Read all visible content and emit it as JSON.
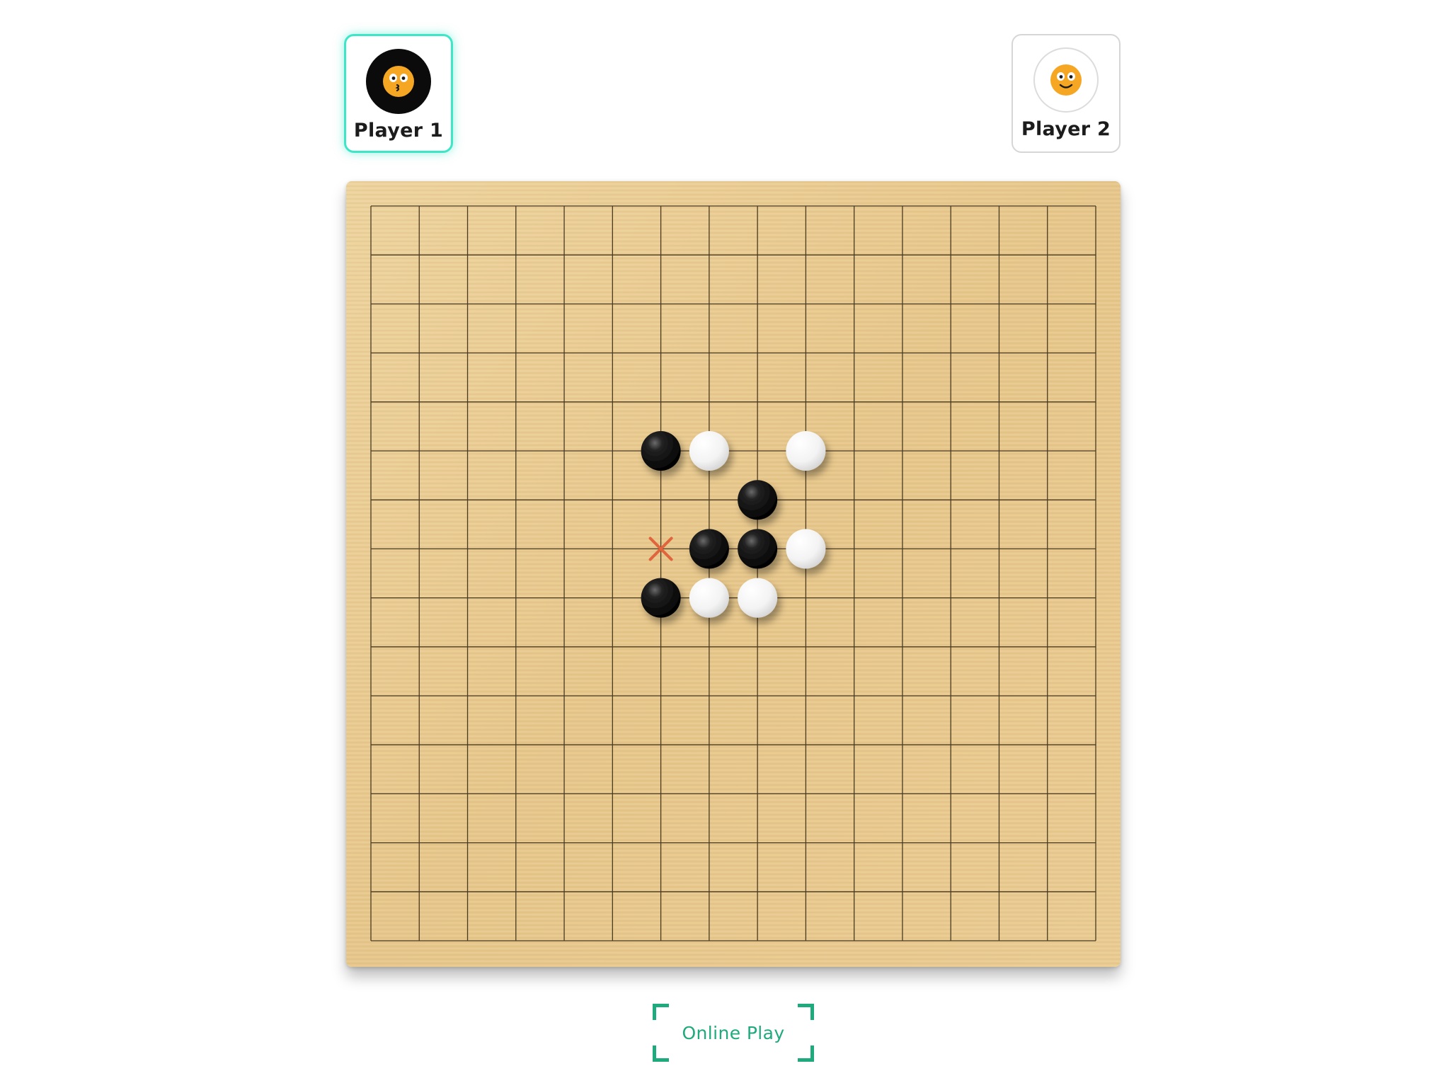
{
  "players": [
    {
      "name": "Player 1",
      "stone": "black",
      "avatar_icon": "kissing-face-icon",
      "active": true
    },
    {
      "name": "Player 2",
      "stone": "white",
      "avatar_icon": "smiling-face-icon",
      "active": false
    }
  ],
  "board": {
    "size": 16,
    "stones": [
      {
        "col": 6,
        "row": 5,
        "color": "black"
      },
      {
        "col": 7,
        "row": 5,
        "color": "white"
      },
      {
        "col": 9,
        "row": 5,
        "color": "white"
      },
      {
        "col": 8,
        "row": 6,
        "color": "black"
      },
      {
        "col": 7,
        "row": 7,
        "color": "black"
      },
      {
        "col": 8,
        "row": 7,
        "color": "black"
      },
      {
        "col": 9,
        "row": 7,
        "color": "white"
      },
      {
        "col": 6,
        "row": 8,
        "color": "black"
      },
      {
        "col": 7,
        "row": 8,
        "color": "white"
      },
      {
        "col": 8,
        "row": 8,
        "color": "white"
      }
    ],
    "last_move_marker": {
      "col": 6,
      "row": 7,
      "icon": "x-mark-icon"
    }
  },
  "online_play": {
    "label": "Online Play"
  },
  "colors": {
    "active_border": "#3ee6c8",
    "accent_green": "#1faa7d",
    "board_wood": "#e8c98e",
    "grid_line": "#4a3a22",
    "marker": "#e0643c"
  }
}
